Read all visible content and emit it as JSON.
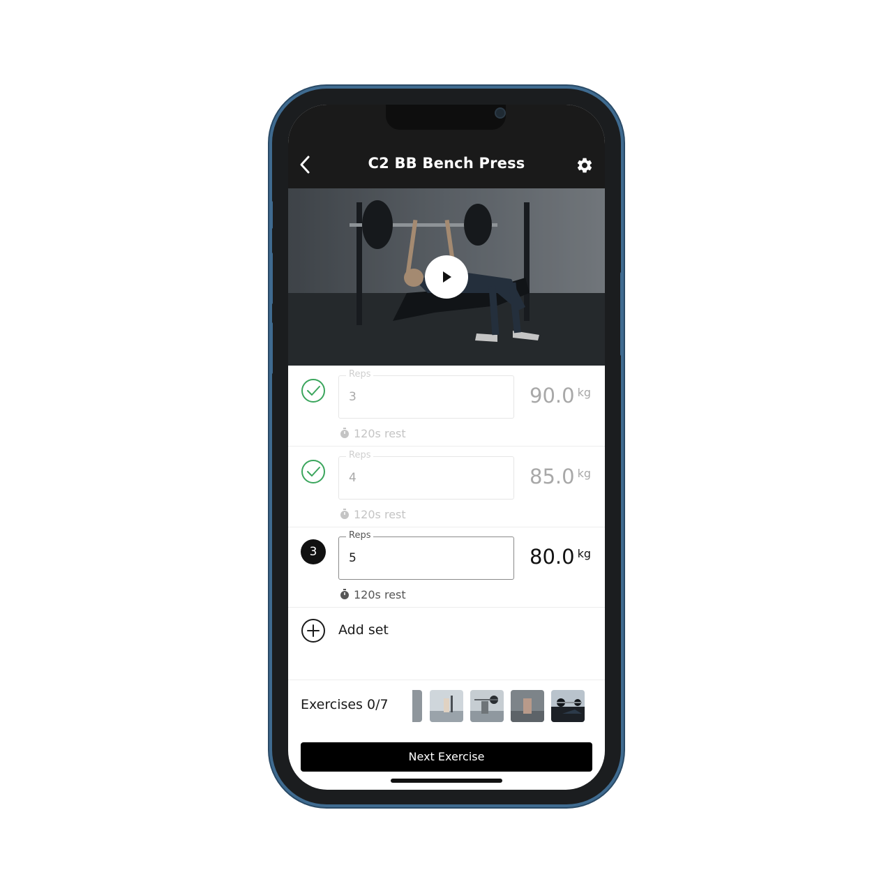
{
  "header": {
    "title": "C2 BB Bench Press",
    "back_icon": "chevron-left-icon",
    "settings_icon": "gear-icon"
  },
  "video": {
    "play_icon": "play-icon"
  },
  "sets": [
    {
      "status": "completed",
      "reps_label": "Reps",
      "reps": "3",
      "weight": "90.0",
      "unit": "kg",
      "rest": "120s rest"
    },
    {
      "status": "completed",
      "reps_label": "Reps",
      "reps": "4",
      "weight": "85.0",
      "unit": "kg",
      "rest": "120s rest"
    },
    {
      "status": "active",
      "number": "3",
      "reps_label": "Reps",
      "reps": "5",
      "weight": "80.0",
      "unit": "kg",
      "rest": "120s rest"
    }
  ],
  "add_set": {
    "label": "Add set"
  },
  "exercises": {
    "label": "Exercises 0/7"
  },
  "next_button": {
    "label": "Next Exercise"
  },
  "colors": {
    "check_green": "#3aa55c",
    "phone_frame": "#3f6b90",
    "topbar": "#1a1a1a",
    "button": "#000000"
  }
}
